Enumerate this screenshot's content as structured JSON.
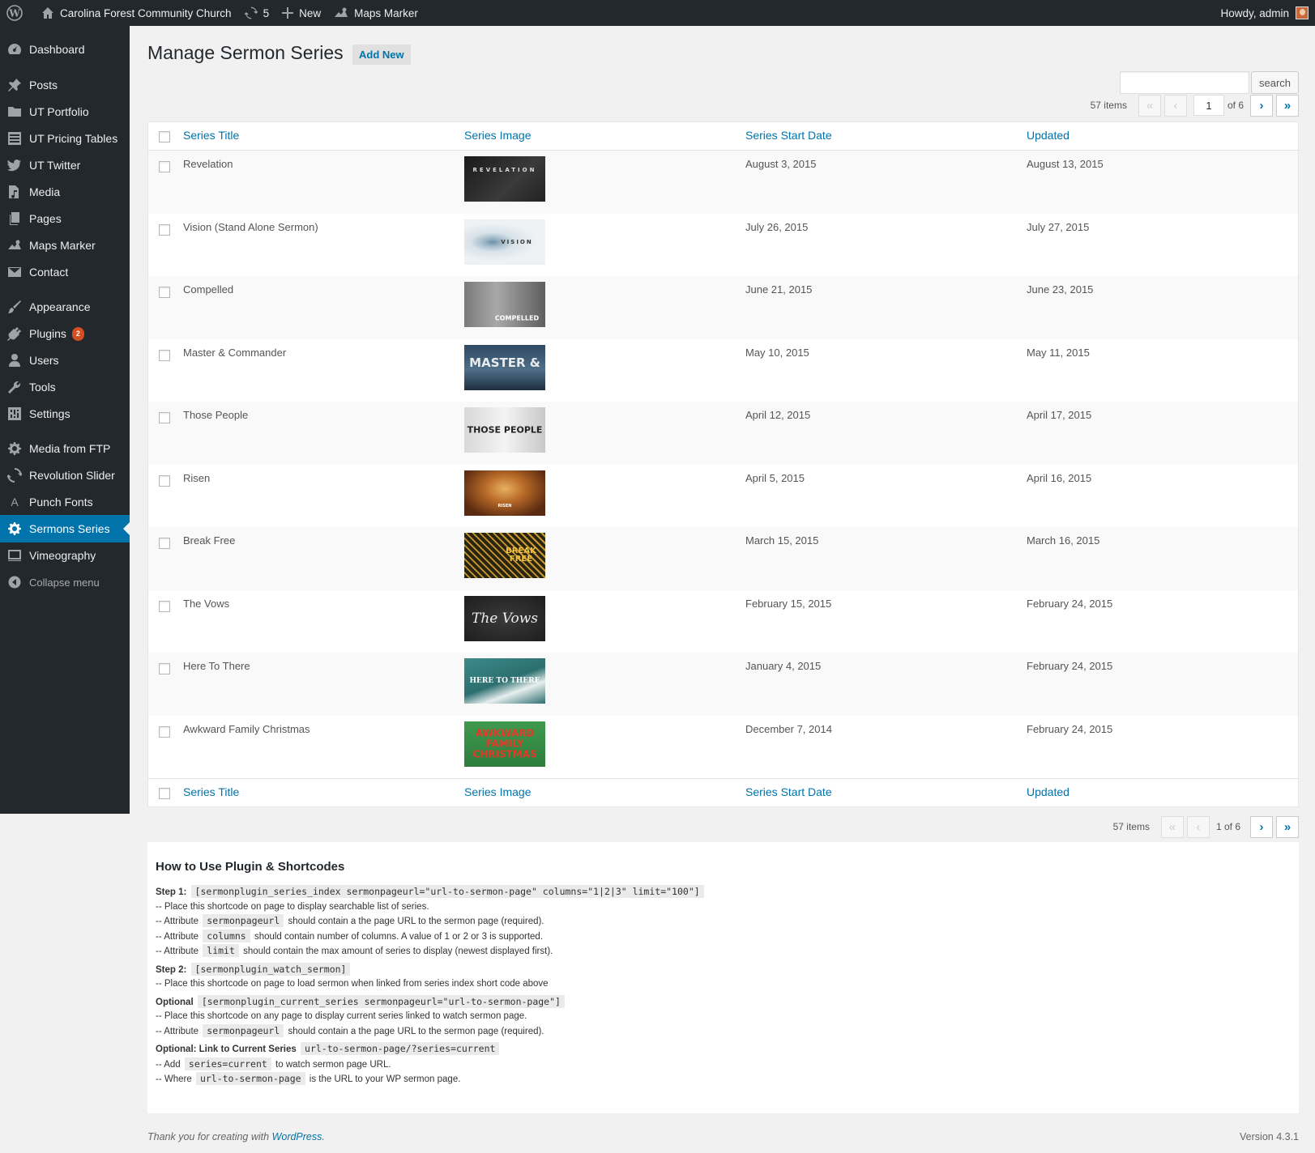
{
  "adminbar": {
    "site_name": "Carolina Forest Community Church",
    "updates_count": "5",
    "new_label": "New",
    "maps_marker": "Maps Marker",
    "howdy": "Howdy, admin"
  },
  "sidebar": {
    "items": [
      {
        "label": "Dashboard",
        "icon": "dashboard-icon"
      },
      {
        "label": "Posts",
        "icon": "pin-icon"
      },
      {
        "label": "UT Portfolio",
        "icon": "folder-icon"
      },
      {
        "label": "UT Pricing Tables",
        "icon": "list-icon"
      },
      {
        "label": "UT Twitter",
        "icon": "twitter-icon"
      },
      {
        "label": "Media",
        "icon": "media-icon"
      },
      {
        "label": "Pages",
        "icon": "pages-icon"
      },
      {
        "label": "Maps Marker",
        "icon": "map-icon"
      },
      {
        "label": "Contact",
        "icon": "mail-icon"
      },
      {
        "label": "Appearance",
        "icon": "brush-icon"
      },
      {
        "label": "Plugins",
        "icon": "plugin-icon",
        "badge": "2"
      },
      {
        "label": "Users",
        "icon": "user-icon"
      },
      {
        "label": "Tools",
        "icon": "wrench-icon"
      },
      {
        "label": "Settings",
        "icon": "settings-icon"
      },
      {
        "label": "Media from FTP",
        "icon": "gear-icon"
      },
      {
        "label": "Revolution Slider",
        "icon": "refresh-icon"
      },
      {
        "label": "Punch Fonts",
        "icon": "font-icon"
      },
      {
        "label": "Sermons Series",
        "icon": "gear-icon"
      },
      {
        "label": "Vimeography",
        "icon": "video-icon"
      },
      {
        "label": "Collapse menu",
        "icon": "collapse-icon"
      }
    ]
  },
  "page": {
    "title": "Manage Sermon Series",
    "add_new": "Add New",
    "search_button": "search",
    "search_value": ""
  },
  "pagination_top": {
    "items": "57 items",
    "first": "«",
    "prev": "‹",
    "current_page": "1",
    "of_pages": "of 6",
    "next": "›",
    "last": "»"
  },
  "pagination_bottom": {
    "items": "57 items",
    "first": "«",
    "prev": "‹",
    "page_text": "1 of 6",
    "next": "›",
    "last": "»"
  },
  "table": {
    "columns": [
      "Series Title",
      "Series Image",
      "Series Start Date",
      "Updated"
    ],
    "rows": [
      {
        "title": "Revelation",
        "image_text": "REVELATION",
        "start": "August 3, 2015",
        "updated": "August 13, 2015"
      },
      {
        "title": "Vision (Stand Alone Sermon)",
        "image_text": "VISION",
        "start": "July 26, 2015",
        "updated": "July 27, 2015"
      },
      {
        "title": "Compelled",
        "image_text": "COMPELLED",
        "start": "June 21, 2015",
        "updated": "June 23, 2015"
      },
      {
        "title": "Master & Commander",
        "image_text": "MASTER &",
        "start": "May 10, 2015",
        "updated": "May 11, 2015"
      },
      {
        "title": "Those People",
        "image_text": "THOSE PEOPLE",
        "start": "April 12, 2015",
        "updated": "April 17, 2015"
      },
      {
        "title": "Risen",
        "image_text": "RISEN",
        "start": "April 5, 2015",
        "updated": "April 16, 2015"
      },
      {
        "title": "Break Free",
        "image_text": "BREAK FREE",
        "start": "March 15, 2015",
        "updated": "March 16, 2015"
      },
      {
        "title": "The Vows",
        "image_text": "The Vows",
        "start": "February 15, 2015",
        "updated": "February 24, 2015"
      },
      {
        "title": "Here To There",
        "image_text": "HERE TO THERE",
        "start": "January 4, 2015",
        "updated": "February 24, 2015"
      },
      {
        "title": "Awkward Family Christmas",
        "image_text": "AWKWARD FAMILY CHRISTMAS",
        "start": "December 7, 2014",
        "updated": "February 24, 2015"
      }
    ]
  },
  "help": {
    "heading": "How to Use Plugin & Shortcodes",
    "step1_label": "Step 1:",
    "step1_code": "[sermonplugin_series_index sermonpageurl=\"url-to-sermon-page\" columns=\"1|2|3\" limit=\"100\"]",
    "step1_l1": "-- Place this shortcode on page to display searchable list of series.",
    "attr_prefix": "-- Attribute",
    "step1_l2_code": "sermonpageurl",
    "step1_l2_text": "should contain a the page URL to the sermon page (required).",
    "step1_l3_code": "columns",
    "step1_l3_text": "should contain number of columns. A value of 1 or 2 or 3 is supported.",
    "step1_l4_code": "limit",
    "step1_l4_text": "should contain the max amount of series to display (newest displayed first).",
    "step2_label": "Step 2:",
    "step2_code": "[sermonplugin_watch_sermon]",
    "step2_l1": "-- Place this shortcode on page to load sermon when linked from series index short code above",
    "opt_label": "Optional",
    "opt_code": "[sermonplugin_current_series sermonpageurl=\"url-to-sermon-page\"]",
    "opt_l1": "-- Place this shortcode on any page to display current series linked to watch sermon page.",
    "opt_l2_code": "sermonpageurl",
    "opt_l2_text": "should contain a the page URL to the sermon page (required).",
    "link_label": "Optional: Link to Current Series",
    "link_code": "url-to-sermon-page/?series=current",
    "link_l1_prefix": "-- Add",
    "link_l1_code": "series=current",
    "link_l1_text": "to watch sermon page URL.",
    "link_l2_prefix": "-- Where",
    "link_l2_code": "url-to-sermon-page",
    "link_l2_text": "is the URL to your WP sermon page."
  },
  "footer": {
    "thanks": "Thank you for creating with",
    "wp_link": "WordPress",
    "period": ".",
    "version": "Version 4.3.1"
  },
  "colors": {
    "accent": "#0073aa",
    "adminbar": "#23282d",
    "badge": "#d54e21"
  }
}
